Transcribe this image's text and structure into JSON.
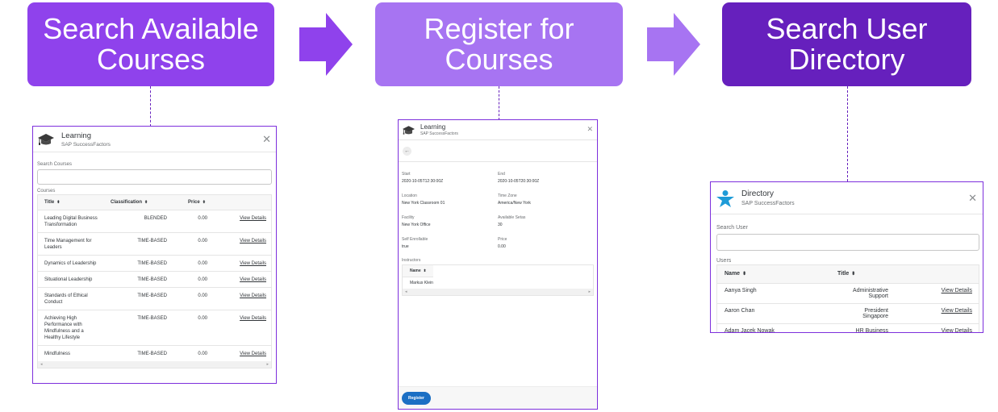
{
  "colors": {
    "step1": "#8f42ec",
    "step2": "#a774f2",
    "step3": "#6620bd",
    "arrow1": "#8f42ec",
    "arrow2": "#a774f2",
    "panel_border": "#7d2fdc",
    "register_button": "#1b6fc4",
    "directory_icon": "#1e9bd7"
  },
  "steps": [
    {
      "label": "Search Available\nCourses"
    },
    {
      "label": "Register for\nCourses"
    },
    {
      "label": "Search User\nDirectory"
    }
  ],
  "search_courses_panel": {
    "icon": "graduation-cap-icon",
    "title": "Learning",
    "subtitle": "SAP SuccessFactors",
    "close_icon": "close-icon",
    "search_label": "Search Courses",
    "search_value": "",
    "table_label": "Courses",
    "columns": [
      "Title",
      "Classification",
      "Price",
      ""
    ],
    "sort_icon": "⬍",
    "rows": [
      {
        "title": "Leading Digital Business Transformation",
        "classification": "BLENDED",
        "price": "0.00",
        "action": "View Details"
      },
      {
        "title": "Time Management for Leaders",
        "classification": "TIME-BASED",
        "price": "0.00",
        "action": "View Details"
      },
      {
        "title": "Dynamics of Leadership",
        "classification": "TIME-BASED",
        "price": "0.00",
        "action": "View Details"
      },
      {
        "title": "Situational Leadership",
        "classification": "TIME-BASED",
        "price": "0.00",
        "action": "View Details"
      },
      {
        "title": "Standards of Ethical Conduct",
        "classification": "TIME-BASED",
        "price": "0.00",
        "action": "View Details"
      },
      {
        "title": "Achieving High Performance with Mindfulness and a Healthy Lifestyle",
        "classification": "TIME-BASED",
        "price": "0.00",
        "action": "View Details"
      },
      {
        "title": "Mindfulness",
        "classification": "TIME-BASED",
        "price": "0.00",
        "action": "View Details"
      }
    ]
  },
  "register_panel": {
    "icon": "graduation-cap-icon",
    "title": "Learning",
    "subtitle": "SAP SuccessFactors",
    "back_icon": "←",
    "fields": [
      {
        "label": "Start",
        "value": "2020-10-05T12:30:00Z"
      },
      {
        "label": "End",
        "value": "2020-10-05T20:30:00Z"
      },
      {
        "label": "Location",
        "value": "New York Classroom 01"
      },
      {
        "label": "Time Zone",
        "value": "America/New York"
      },
      {
        "label": "Facility",
        "value": "New York Office"
      },
      {
        "label": "Available Setas",
        "value": "30"
      },
      {
        "label": "Self Enrollable",
        "value": "true"
      },
      {
        "label": "Price",
        "value": "0.00"
      }
    ],
    "instructors_label": "Instructors",
    "instructors_column": "Name",
    "instructors": [
      "Markus Klein"
    ],
    "register_label": "Register"
  },
  "directory_panel": {
    "icon": "person-star-icon",
    "title": "Directory",
    "subtitle": "SAP SuccessFactors",
    "search_label": "Search User",
    "search_value": "",
    "table_label": "Users",
    "columns": [
      "Name",
      "Title",
      ""
    ],
    "rows": [
      {
        "name": "Aanya Singh",
        "title": "Administrative Support",
        "action": "View Details"
      },
      {
        "name": "Aaron Chan",
        "title": "President Singapore",
        "action": "View Details"
      },
      {
        "name": "Adam Jacek Nowak",
        "title": "HR Business Partner Poland",
        "action": "View Details"
      }
    ]
  }
}
